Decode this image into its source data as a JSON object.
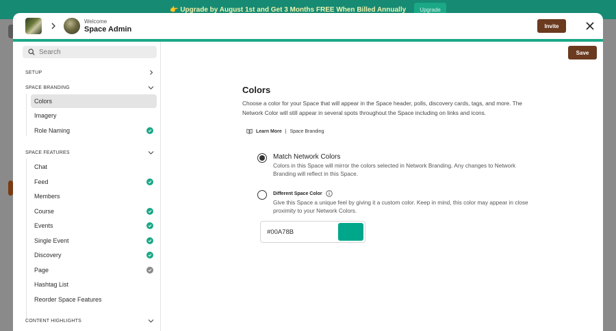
{
  "banner": {
    "text": "👉 Upgrade by August 1st and Get 3 Months FREE When Billed Annually",
    "button": "Upgrade"
  },
  "header": {
    "welcome": "Welcome",
    "space_name": "Space Admin",
    "invite": "Invite"
  },
  "search": {
    "placeholder": "Search"
  },
  "sidebar": {
    "setup": "SETUP",
    "branding": {
      "label": "SPACE BRANDING",
      "items": [
        {
          "label": "Colors"
        },
        {
          "label": "Imagery"
        },
        {
          "label": "Role Naming"
        }
      ]
    },
    "features": {
      "label": "SPACE FEATURES",
      "items": [
        {
          "label": "Chat"
        },
        {
          "label": "Feed"
        },
        {
          "label": "Members"
        },
        {
          "label": "Course"
        },
        {
          "label": "Events"
        },
        {
          "label": "Single Event"
        },
        {
          "label": "Discovery"
        },
        {
          "label": "Page"
        },
        {
          "label": "Hashtag List"
        },
        {
          "label": "Reorder Space Features"
        }
      ]
    },
    "content": "CONTENT HIGHLIGHTS"
  },
  "main": {
    "save": "Save",
    "title": "Colors",
    "description": "Choose a color for your Space that will appear in the Space header, polls, discovery cards, tags, and more. The Network Color will still appear in several spots throughout the Space including on links and icons.",
    "learn_more": "Learn More",
    "learn_sep": "|",
    "learn_link": "Space Branding",
    "options": {
      "match": {
        "title": "Match Network Colors",
        "desc": "Colors in this Space will mirror the colors selected in Network Branding. Any changes to Network Branding will reflect in this Space."
      },
      "different": {
        "title": "Different Space Color",
        "desc": "Give this Space a unique feel by giving it a custom color. Keep in mind, this color may appear in close proximity to your Network Colors."
      }
    },
    "hex_value": "#00A78B"
  },
  "colors": {
    "accent": "#1AA887",
    "brown": "#6B3A1F",
    "swatch": "#00A78B"
  }
}
